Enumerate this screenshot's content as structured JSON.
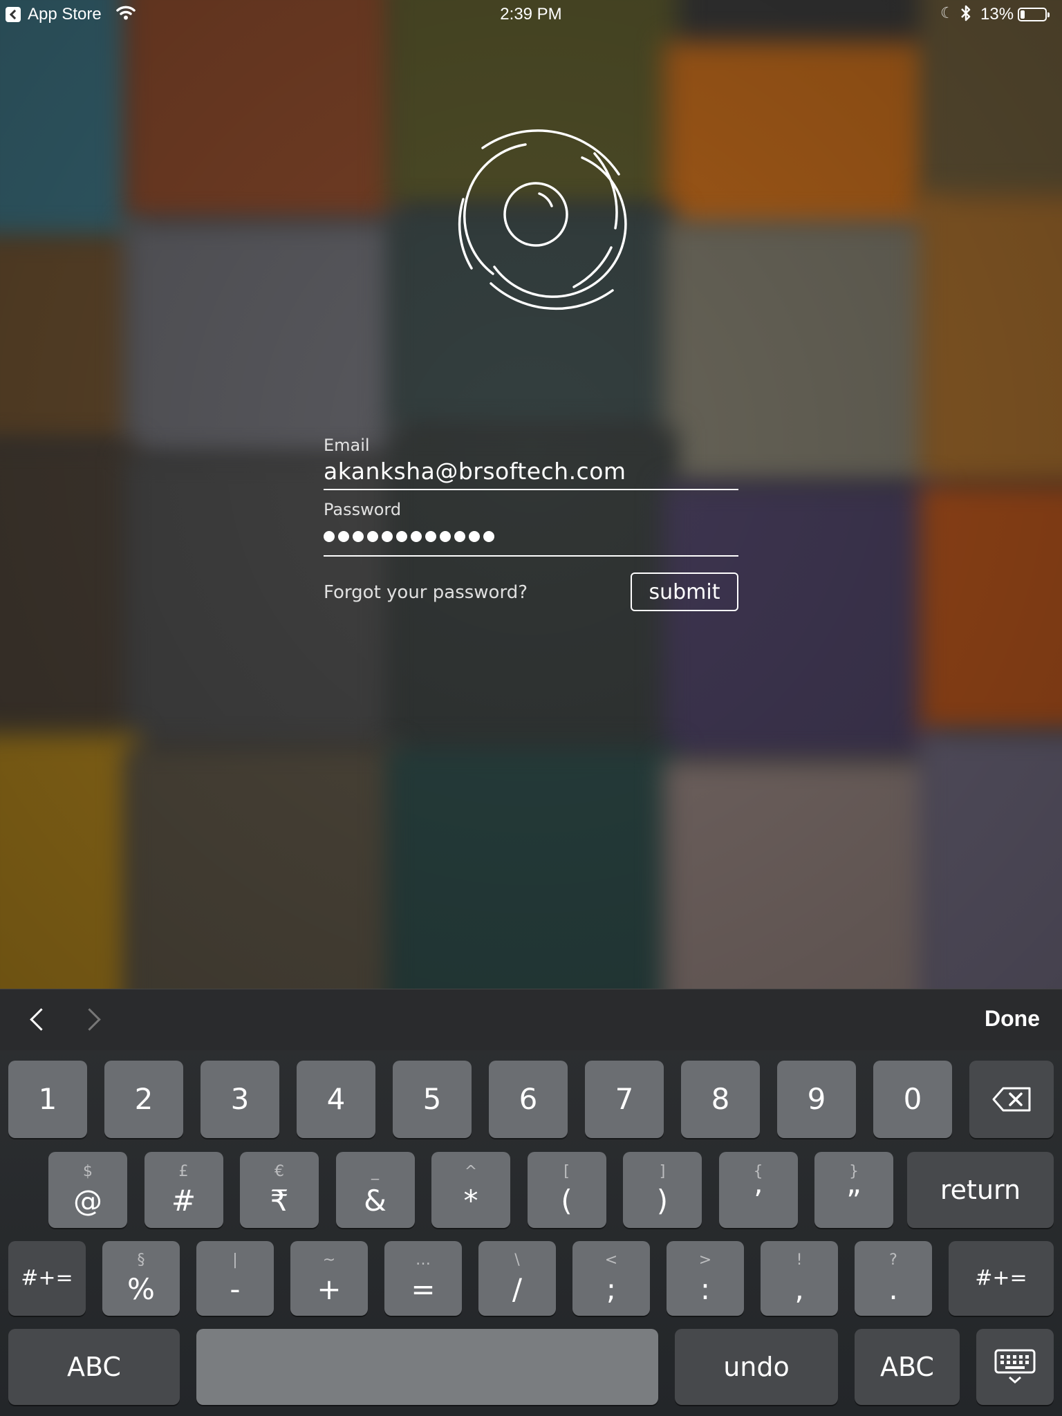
{
  "status_bar": {
    "back_app": "App Store",
    "time": "2:39 PM",
    "battery": "13%"
  },
  "form": {
    "email_label": "Email",
    "email_value": "akanksha@brsoftech.com",
    "password_label": "Password",
    "password_length": 12,
    "forgot_label": "Forgot your password?",
    "submit_label": "submit"
  },
  "keyboard": {
    "done_label": "Done",
    "row1": [
      {
        "main": "1"
      },
      {
        "main": "2"
      },
      {
        "main": "3"
      },
      {
        "main": "4"
      },
      {
        "main": "5"
      },
      {
        "main": "6"
      },
      {
        "main": "7"
      },
      {
        "main": "8"
      },
      {
        "main": "9"
      },
      {
        "main": "0"
      }
    ],
    "row2": [
      {
        "alt": "$",
        "main": "@"
      },
      {
        "alt": "£",
        "main": "#"
      },
      {
        "alt": "€",
        "main": "₹"
      },
      {
        "alt": "_",
        "main": "&"
      },
      {
        "alt": "^",
        "main": "*"
      },
      {
        "alt": "[",
        "main": "("
      },
      {
        "alt": "]",
        "main": ")"
      },
      {
        "alt": "{",
        "main": "’"
      },
      {
        "alt": "}",
        "main": "”"
      }
    ],
    "return_label": "return",
    "symbols_label": "#+=",
    "row3": [
      {
        "alt": "§",
        "main": "%"
      },
      {
        "alt": "|",
        "main": "-"
      },
      {
        "alt": "~",
        "main": "+"
      },
      {
        "alt": "…",
        "main": "="
      },
      {
        "alt": "\\",
        "main": "/"
      },
      {
        "alt": "<",
        "main": ";"
      },
      {
        "alt": ">",
        "main": ":"
      },
      {
        "alt": "!",
        "main": ","
      },
      {
        "alt": "?",
        "main": "."
      }
    ],
    "abc_label": "ABC",
    "undo_label": "undo"
  },
  "colors": {
    "key": "#6b6e72",
    "key_dark": "#47494c",
    "toolbar": "#2a2b2d"
  }
}
